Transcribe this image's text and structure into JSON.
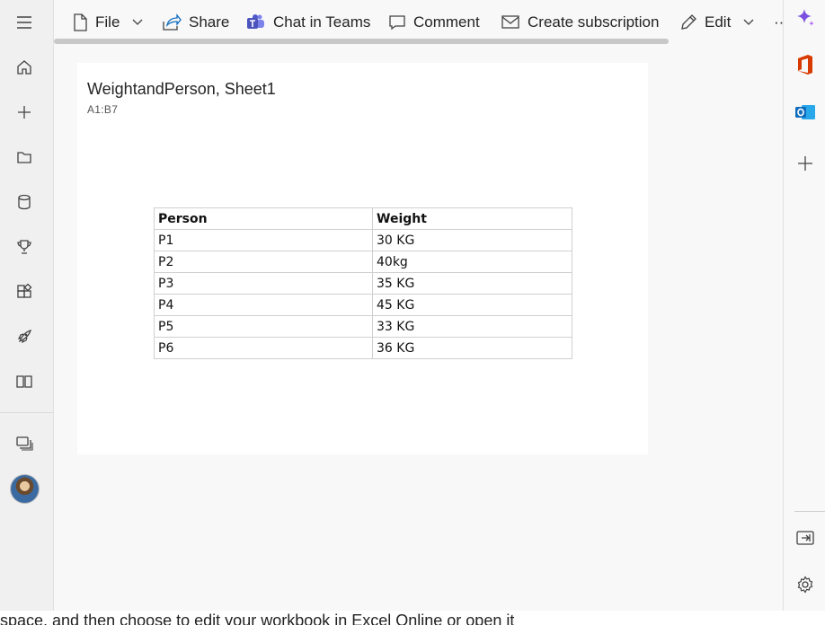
{
  "toolbar": {
    "file_label": "File",
    "share_label": "Share",
    "teams_label": "Chat in Teams",
    "comment_label": "Comment",
    "subscription_label": "Create subscription",
    "edit_label": "Edit",
    "more_label": "···"
  },
  "leftnav": {
    "items": [
      "menu-icon",
      "home-icon",
      "create-icon",
      "browse-icon",
      "datahub-icon",
      "goals-icon",
      "apps-icon",
      "learn-icon",
      "workspaces-icon"
    ]
  },
  "card": {
    "title": "WeightandPerson, Sheet1",
    "range": "A1:B7"
  },
  "sheet": {
    "headers": [
      "Person",
      "Weight"
    ],
    "rows": [
      [
        "P1",
        "30 KG"
      ],
      [
        "P2",
        "40kg"
      ],
      [
        "P3",
        "35 KG"
      ],
      [
        "P4",
        "45 KG"
      ],
      [
        "P5",
        "33 KG"
      ],
      [
        "P6",
        "36 KG"
      ]
    ]
  },
  "footer": {
    "text": "space, and then choose to edit your workbook in Excel Online or open it"
  },
  "colors": {
    "accent": "#5b5fc7",
    "office_red": "#d83b01",
    "outlook_blue": "#0f6cbd"
  }
}
